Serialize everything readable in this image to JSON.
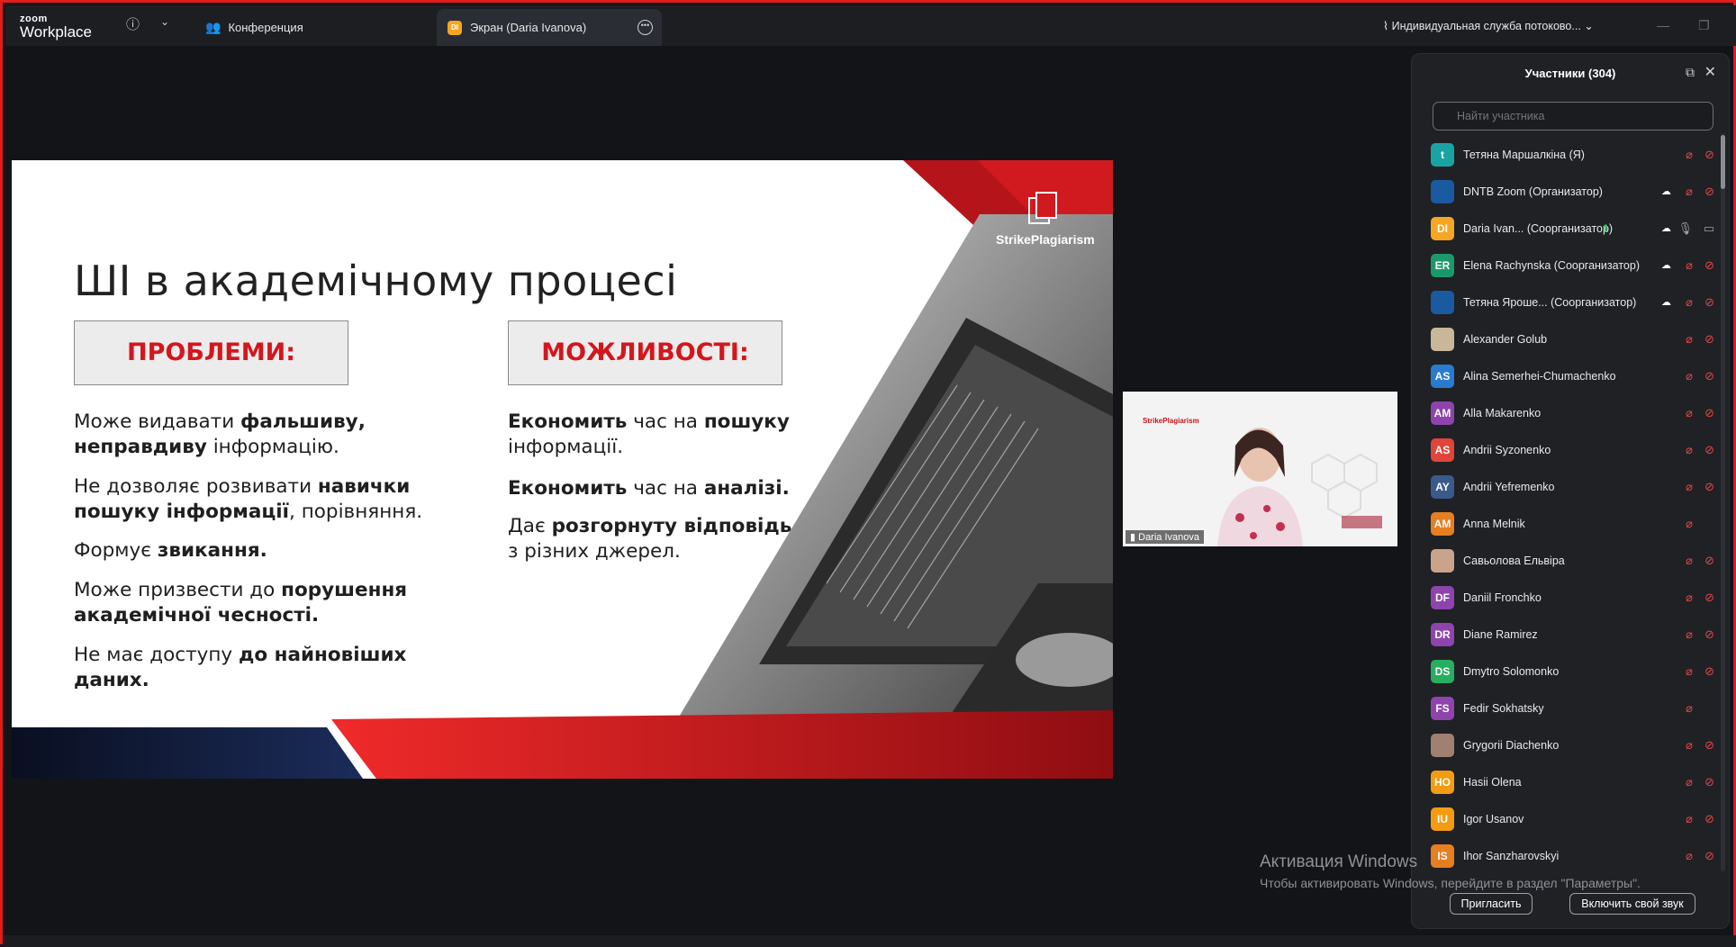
{
  "app": {
    "logo_top": "zoom",
    "logo_bottom": "Workplace",
    "tabs": [
      {
        "label": "Конференция",
        "icon": "people-icon"
      },
      {
        "label": "Экран (Daria Ivanova)",
        "badge": "DI"
      }
    ],
    "stream_label": "Индивидуальная служба потоково...",
    "accent": "#e21b1b"
  },
  "slide": {
    "title": "ШІ в академічному процесі",
    "brand": "StrikePlagiarism",
    "problems_title": "ПРОБЛЕМИ:",
    "opportunities_title": "МОЖЛИВОСТІ:",
    "problems": [
      {
        "a": "Може видавати ",
        "b": "фальшиву,",
        "c": ""
      },
      {
        "a": "",
        "b": "неправдиву",
        "c": " інформацію."
      },
      {
        "a": "Не дозволяє розвивати ",
        "b": "навички",
        "c": ""
      },
      {
        "a": "",
        "b": "пошуку інформації",
        "c": ", порівняння."
      },
      {
        "a": "Формує ",
        "b": "звикання.",
        "c": ""
      },
      {
        "a": "Може призвести до ",
        "b": "порушення",
        "c": ""
      },
      {
        "a": "",
        "b": "академічної чесності.",
        "c": ""
      },
      {
        "a": "Не має доступу ",
        "b": "до найновіших",
        "c": ""
      },
      {
        "a": "",
        "b": "даних.",
        "c": ""
      }
    ],
    "opportunities": [
      {
        "a": "",
        "b": "Економить",
        "c": " час на ",
        "d": "пошуку"
      },
      {
        "a": "інформації.",
        "b": "",
        "c": "",
        "d": ""
      },
      {
        "a": "",
        "b": "Економить",
        "c": " час на ",
        "d": "аналізі."
      },
      {
        "a": "Дає ",
        "b": "розгорнуту відповідь",
        "c": "",
        "d": ""
      },
      {
        "a": "з різних джерел.",
        "b": "",
        "c": "",
        "d": ""
      }
    ]
  },
  "video": {
    "name": "Daria Ivanova",
    "brand": "StrikePlagiarism"
  },
  "participants": {
    "title": "Участники (304)",
    "search_placeholder": "Найти участника",
    "items": [
      {
        "initials": "t",
        "name": "Тетяна Маршалкіна (Я)",
        "color": "#1aa3a3",
        "cloud": false,
        "mic_on": false,
        "cam_on": false
      },
      {
        "initials": "",
        "name": "DNTB Zoom (Организатор)",
        "color": "#1a5aa0",
        "cloud": true,
        "mic_on": false,
        "cam_on": false,
        "photo": true
      },
      {
        "initials": "DI",
        "name": "Daria Ivan...  (Соорганизатор)",
        "color": "#f5a623",
        "cloud": true,
        "mic_on": true,
        "cam_on": true,
        "share": true
      },
      {
        "initials": "ER",
        "name": "Elena Rachynska (Соорганизатор)",
        "color": "#1a9a6a",
        "cloud": true,
        "mic_on": false,
        "cam_on": false
      },
      {
        "initials": "",
        "name": "Тетяна Яроше... (Соорганизатор)",
        "color": "#1a5aa0",
        "cloud": true,
        "mic_on": false,
        "cam_on": false,
        "photo": true
      },
      {
        "initials": "",
        "name": "Alexander Golub",
        "color": "#c9b79a",
        "cloud": false,
        "mic_on": false,
        "cam_on": false,
        "photo": true
      },
      {
        "initials": "AS",
        "name": "Alina Semerhei-Chumachenko",
        "color": "#2a7bd0",
        "cloud": false,
        "mic_on": false,
        "cam_on": false
      },
      {
        "initials": "AM",
        "name": "Alla Makarenko",
        "color": "#8e44ad",
        "cloud": false,
        "mic_on": false,
        "cam_on": false
      },
      {
        "initials": "AS",
        "name": "Andrii Syzonenko",
        "color": "#e0453a",
        "cloud": false,
        "mic_on": false,
        "cam_on": false
      },
      {
        "initials": "AY",
        "name": "Andrii Yefremenko",
        "color": "#3a5a8a",
        "cloud": false,
        "mic_on": false,
        "cam_on": false
      },
      {
        "initials": "AM",
        "name": "Anna Melnik",
        "color": "#e67e22",
        "cloud": false,
        "mic_on": false,
        "no_cam": true
      },
      {
        "initials": "",
        "name": "Савьолова Ельвіра",
        "color": "#c9a38a",
        "cloud": false,
        "mic_on": false,
        "cam_on": false,
        "photo": true
      },
      {
        "initials": "DF",
        "name": "Daniil Fronchko",
        "color": "#8e44ad",
        "cloud": false,
        "mic_on": false,
        "cam_on": false
      },
      {
        "initials": "DR",
        "name": "Diane Ramirez",
        "color": "#8e44ad",
        "cloud": false,
        "mic_on": false,
        "cam_on": false
      },
      {
        "initials": "DS",
        "name": "Dmytro Solomonko",
        "color": "#27ae60",
        "cloud": false,
        "mic_on": false,
        "cam_on": false
      },
      {
        "initials": "FS",
        "name": "Fedir Sokhatsky",
        "color": "#8e44ad",
        "cloud": false,
        "mic_on": false,
        "no_cam": true
      },
      {
        "initials": "",
        "name": "Grygorii Diachenko",
        "color": "#a08070",
        "cloud": false,
        "mic_on": false,
        "cam_on": false,
        "photo": true
      },
      {
        "initials": "HO",
        "name": "Hasii Olena",
        "color": "#f39c12",
        "cloud": false,
        "mic_on": false,
        "cam_on": false
      },
      {
        "initials": "IU",
        "name": "Igor Usanov",
        "color": "#f39c12",
        "cloud": false,
        "mic_on": false,
        "cam_on": false
      },
      {
        "initials": "IS",
        "name": "Ihor Sanzharovskyi",
        "color": "#e67e22",
        "cloud": false,
        "mic_on": false,
        "cam_on": false
      }
    ],
    "invite_label": "Пригласить",
    "unmute_label": "Включить свой звук"
  },
  "watermark": {
    "line1": "Активация Windows",
    "line2": "Чтобы активировать Windows, перейдите в раздел \"Параметры\"."
  }
}
